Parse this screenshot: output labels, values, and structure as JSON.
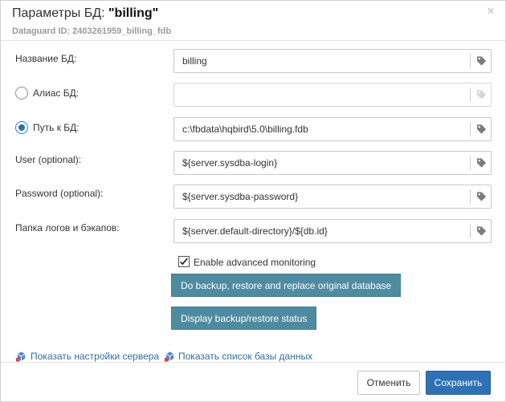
{
  "dialog": {
    "title_prefix": "Параметры БД: ",
    "title_name": "\"billing\"",
    "subtitle": "Dataguard ID: 2403261959_billing_fdb",
    "close_icon": "close-icon"
  },
  "form": {
    "db_name": {
      "label": "Название БД:",
      "value": "billing"
    },
    "db_alias": {
      "label": "Алиас БД:",
      "value": "",
      "selected": false
    },
    "db_path": {
      "label": "Путь к БД:",
      "value": "c:\\fbdata\\hqbird\\5.0\\billing.fdb",
      "selected": true
    },
    "user": {
      "label": "User (optional):",
      "value": "${server.sysdba-login}"
    },
    "password": {
      "label": "Password (optional):",
      "value": "${server.sysdba-password}"
    },
    "logs_folder": {
      "label": "Папка логов и бэкапов:",
      "value": "${server.default-directory}/${db.id}"
    }
  },
  "monitoring": {
    "label": "Enable advanced monitoring",
    "checked": true
  },
  "actions": {
    "backup_restore_label": "Do backup, restore and replace original database",
    "status_label": "Display backup/restore status"
  },
  "links": {
    "server_settings": "Показать настройки сервера",
    "db_list": "Показать список базы данных"
  },
  "footer": {
    "cancel_label": "Отменить",
    "save_label": "Сохранить"
  },
  "icons": {
    "field_tag": "tag-icon",
    "link": "cube-icon"
  },
  "colors": {
    "primary": "#2e72b5",
    "secondary_button": "#4f8ba0",
    "link": "#2f6f9f"
  }
}
